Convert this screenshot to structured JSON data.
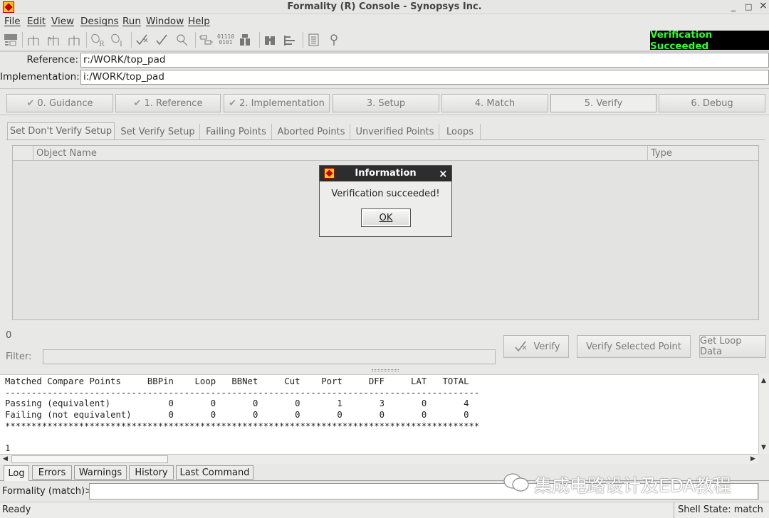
{
  "window": {
    "title": "Formality (R) Console - Synopsys Inc.",
    "minimize": "_",
    "maximize": "□",
    "close": "×"
  },
  "menubar": [
    "File",
    "Edit",
    "View",
    "Designs",
    "Run",
    "Window",
    "Help"
  ],
  "toolbar_icons": [
    "vars-icon",
    "ref-tree-icon",
    "impl-tree-icon",
    "match-tree-icon",
    "pin-r-icon",
    "pin-i-icon",
    "verify-icon",
    "verify-selected-icon",
    "debug-icon",
    "bits-icon",
    "binary-icon",
    "compare-icon",
    "find-icon",
    "schematic-icon",
    "report-icon",
    "help-icon"
  ],
  "verification_status": "Verification Succeeded",
  "design": {
    "reference_label": "Reference:",
    "reference_value": "r:/WORK/top_pad",
    "implementation_label": "Implementation:",
    "implementation_value": "i:/WORK/top_pad"
  },
  "steps": [
    "0. Guidance",
    "1. Reference",
    "2. Implementation",
    "3. Setup",
    "4. Match",
    "5. Verify",
    "6. Debug"
  ],
  "active_step": "5. Verify",
  "subtabs": [
    "Set Don't Verify Setup",
    "Set Verify Setup",
    "Failing Points",
    "Aborted Points",
    "Unverified Points",
    "Loops"
  ],
  "table": {
    "col_name": "Object Name",
    "col_type": "Type"
  },
  "count": "0",
  "filter_label": "Filter:",
  "buttons": {
    "verify": "Verify",
    "verify_selected": "Verify Selected Point",
    "get_loop": "Get Loop Data"
  },
  "dialog": {
    "title": "Information",
    "message": "Verification succeeded!",
    "ok": "OK",
    "close": "×"
  },
  "console_lines": [
    "Matched Compare Points     BBPin    Loop   BBNet     Cut    Port     DFF     LAT   TOTAL",
    "------------------------------------------------------------------------------------------",
    "Passing (equivalent)           0       0       0       0       1       3       0       4",
    "Failing (not equivalent)       0       0       0       0       0       0       0       0",
    "******************************************************************************************",
    "",
    "1"
  ],
  "bottom_tabs": [
    "Log",
    "Errors",
    "Warnings",
    "History",
    "Last Command"
  ],
  "prompt_label": "Formality (match)>",
  "watermark": "集成电路设计及EDA教程",
  "status": {
    "left": "Ready",
    "right": "Shell State: match"
  },
  "colors": {
    "status_bg": "#000000",
    "status_fg": "#2cff2c",
    "dialog_title_bg": "#2d2d2d"
  }
}
